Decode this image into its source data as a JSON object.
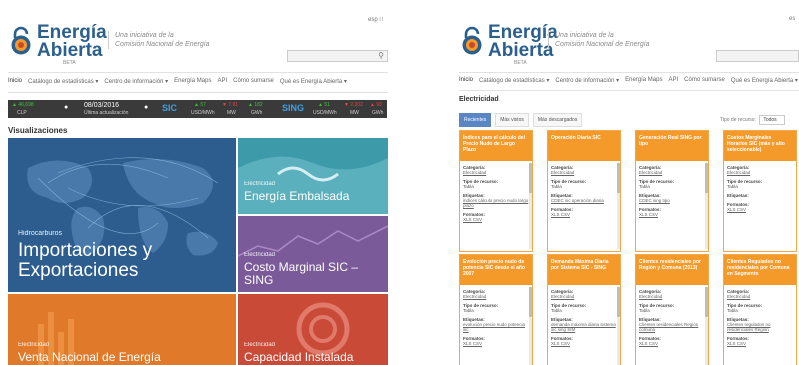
{
  "left": {
    "lang": "esp",
    "logo": {
      "line1": "Energía",
      "line2": "Abierta",
      "beta": "BETA"
    },
    "tagline": {
      "line1": "Una iniciativa de la",
      "line2": "Comisión Nacional de Energía"
    },
    "nav": [
      "Inicio",
      "Catálogo de estadísticas ▾",
      "Centro de información ▾",
      "Energía Maps",
      "API",
      "Cómo sumarse",
      "Qué es Energía Abierta ▾"
    ],
    "ticker": {
      "clp_value": "▲ 46,698",
      "clp_unit": "CLP",
      "date": "08/03/2016",
      "date_label": "Última actualización",
      "sic_label": "SIC",
      "sic_v1": "▲ 57",
      "sic_u1": "USD/MWh",
      "sic_v2": "▼ 7.91",
      "sic_u2": "MW",
      "sic_v3": "▲ 182",
      "sic_u3": "GWh",
      "sing_label": "SING",
      "sing_v1": "▲ 51",
      "sing_u1": "USD/MWh",
      "sing_v2": "▼ 2.202",
      "sing_u2": "MW",
      "sing_v3": "▲ 93",
      "sing_u3": "GWh"
    },
    "section": "Visualizaciones",
    "tiles": [
      {
        "category": "Hidrocarburos",
        "title1": "Importaciones y",
        "title2": "Exportaciones"
      },
      {
        "category": "Electricidad",
        "title1": "Energía Embalsada",
        "title2": ""
      },
      {
        "category": "Electricidad",
        "title1": "Costo Marginal SIC –",
        "title2": "SING"
      },
      {
        "category": "Electricidad",
        "title1": "Venta Nacional de Energía",
        "title2": ""
      },
      {
        "category": "Electricidad",
        "title1": "Capacidad Instalada",
        "title2": ""
      }
    ]
  },
  "right": {
    "lang": "es",
    "logo": {
      "line1": "Energía",
      "line2": "Abierta",
      "beta": "BETA"
    },
    "tagline": {
      "line1": "Una iniciativa de la",
      "line2": "Comisión Nacional de Energía"
    },
    "nav": [
      "Inicio",
      "Catálogo de estadísticas ▾",
      "Centro de información ▾",
      "Energía Maps",
      "API",
      "Cómo sumarse",
      "Qué es Energía Abierta ▾"
    ],
    "section": "Electricidad",
    "tabs": [
      "Recientes",
      "Más vistos",
      "Más descargados"
    ],
    "filter_label": "Tipo de recurso:",
    "filter_value": "Todos",
    "labels": {
      "category": "Categoría:",
      "type": "Tipo de recurso:",
      "tags": "Etiquetas:",
      "formats": "Formatos:"
    },
    "cards": [
      {
        "title": "Índices para el cálculo del Precio Nudo de Largo Plazo",
        "category": "Electricidad",
        "type": "Tabla",
        "tags": "indices cálculo precio nudo largo plazo",
        "formats": "XLS CSV"
      },
      {
        "title": "Operación Diaria SIC",
        "category": "Electricidad",
        "type": "Tabla",
        "tags": "CDEC sic operación diaria",
        "formats": "XLS CSV"
      },
      {
        "title": "Generación Real SING por tipo",
        "category": "Electricidad",
        "type": "Tabla",
        "tags": "CDEC sing tipo",
        "formats": "XLS CSV"
      },
      {
        "title": "Costos Marginales Horarios SIC (más y alto seleccionable)",
        "category": "Electricidad",
        "type": "Tabla",
        "tags": "",
        "formats": "XLS CSV"
      },
      {
        "title": "Evolución precio nudo de potencia SIC desde el año 2007",
        "category": "Electricidad",
        "type": "Tabla",
        "tags": "evolución precio nudo potencia sic",
        "formats": "XLS CSV"
      },
      {
        "title": "Demanda Máxima Diaria por Sistema SIC - SING",
        "category": "Electricidad",
        "type": "Tabla",
        "tags": "demanda máxima diaria sistema sic sing SIM",
        "formats": "XLS CSV"
      },
      {
        "title": "Clientes residenciales por Región y Comuna (2013)",
        "category": "Electricidad",
        "type": "Tabla",
        "tags": "Clientes residenciales Región comuna",
        "formats": "XLS CSV"
      },
      {
        "title": "Clientes Regulados no residenciales por Comuna en Segmento",
        "category": "Electricidad",
        "type": "Tabla",
        "tags": "Clientes regulados no residenciales Región",
        "formats": "XLS CSV"
      }
    ]
  }
}
